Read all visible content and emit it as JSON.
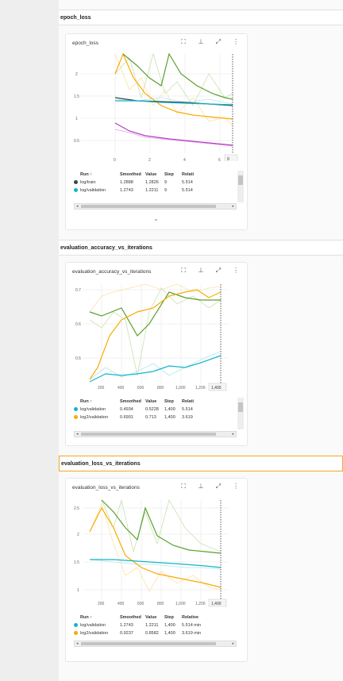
{
  "sections": [
    {
      "header": "epoch_loss"
    },
    {
      "header": "evaluation_accuracy_vs_iterations"
    },
    {
      "header": "evaluation_loss_vs_iterations"
    }
  ],
  "cards": [
    {
      "title": "epoch_loss",
      "x_tick_labels": [
        "0",
        "2",
        "4",
        "6",
        "8"
      ],
      "y_tick_labels": [
        "2",
        "1.5",
        "1",
        "0.5"
      ],
      "hover_step": "9",
      "table_headers": [
        "Run ↑",
        "Smoothed",
        "Value",
        "Step",
        "Relati"
      ],
      "rows": [
        {
          "run": "log/train",
          "smoothed": "1.2888",
          "value": "1.2826",
          "step": "9",
          "relative": "5.514"
        },
        {
          "run": "log/validation",
          "smoothed": "1.2743",
          "value": "1.2211",
          "step": "9",
          "relative": "5.514"
        }
      ]
    },
    {
      "title": "evaluation_accuracy_vs_iterations",
      "x_tick_labels": [
        "200",
        "400",
        "600",
        "800",
        "1,000",
        "1,200"
      ],
      "y_tick_labels": [
        "0.7",
        "0.6",
        "0.5"
      ],
      "hover_step": "1,400",
      "table_headers": [
        "Run ↑",
        "Smoothed",
        "Value",
        "Step",
        "Relati"
      ],
      "rows": [
        {
          "run": "log/validation",
          "smoothed": "0.4934",
          "value": "0.5228",
          "step": "1,400",
          "relative": "5.514"
        },
        {
          "run": "log2/validation",
          "smoothed": "0.6901",
          "value": "0.713",
          "step": "1,400",
          "relative": "3.619"
        }
      ]
    },
    {
      "title": "evaluation_loss_vs_iterations",
      "x_tick_labels": [
        "200",
        "400",
        "600",
        "800",
        "1,000",
        "1,200"
      ],
      "y_tick_labels": [
        "2.5",
        "2",
        "1.5",
        "1"
      ],
      "hover_step": "1,400",
      "table_headers": [
        "Run ↑",
        "Smoothed",
        "Value",
        "Step",
        "Relative"
      ],
      "rows": [
        {
          "run": "log/validation",
          "smoothed": "1.2743",
          "value": "1.2211",
          "step": "1,400",
          "relative": "5.514 min"
        },
        {
          "run": "log2/validation",
          "smoothed": "0.9237",
          "value": "0.8582",
          "step": "1,400",
          "relative": "3.619 min"
        }
      ]
    }
  ],
  "colors": {
    "train_dark": "#37474f",
    "validation_cyan": "#12b5cb",
    "log2_orange": "#f9ab00",
    "log2_green": "#5aa02c",
    "magenta": "#b23cc4",
    "accent_border": "#f5a623"
  },
  "icons": {
    "fit": "fit-domain-icon",
    "pin": "pin-icon",
    "fullscreen": "fullscreen-icon",
    "more": "more-vert-icon",
    "expand": "chevron-down-icon"
  }
}
